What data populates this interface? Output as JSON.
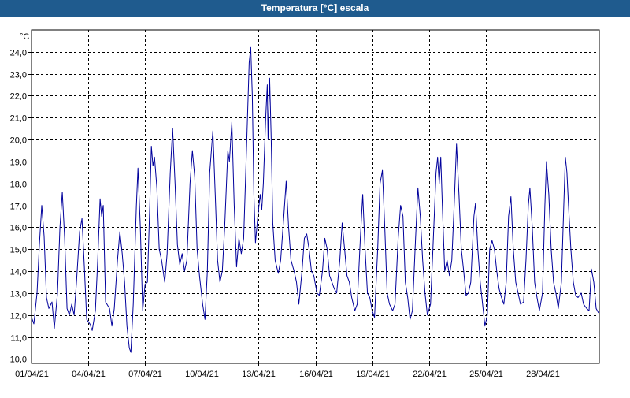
{
  "window": {
    "title": "Temperatura [°C] escala"
  },
  "colors": {
    "titlebar": "#1f5b8e",
    "series": "#00009c",
    "grid": "#000000"
  },
  "chart_data": {
    "type": "line",
    "title": "Temperatura [°C] escala",
    "ylabel": "°C",
    "xlabel": "",
    "ylim": [
      9.8,
      25.0
    ],
    "xlim": [
      "2021-04-01",
      "2021-05-01"
    ],
    "grid": true,
    "y_ticks": [
      "10,0",
      "11,0",
      "12,0",
      "13,0",
      "14,0",
      "15,0",
      "16,0",
      "17,0",
      "18,0",
      "19,0",
      "20,0",
      "21,0",
      "22,0",
      "23,0",
      "24,0"
    ],
    "x_ticks": [
      "01/04/21",
      "04/04/21",
      "07/04/21",
      "10/04/21",
      "13/04/21",
      "16/04/21",
      "19/04/21",
      "22/04/21",
      "25/04/21",
      "28/04/21"
    ],
    "x_tick_dates": [
      "2021-04-01",
      "2021-04-04",
      "2021-04-07",
      "2021-04-10",
      "2021-04-13",
      "2021-04-16",
      "2021-04-19",
      "2021-04-22",
      "2021-04-25",
      "2021-04-28"
    ],
    "series": [
      {
        "points": [
          [
            "2021-04-01 00:00",
            11.9
          ],
          [
            "2021-04-01 03:00",
            11.6
          ],
          [
            "2021-04-01 07:00",
            13.0
          ],
          [
            "2021-04-01 10:00",
            15.2
          ],
          [
            "2021-04-01 13:00",
            17.0
          ],
          [
            "2021-04-01 16:00",
            15.6
          ],
          [
            "2021-04-01 19:00",
            12.8
          ],
          [
            "2021-04-01 22:00",
            12.3
          ],
          [
            "2021-04-02 02:00",
            12.6
          ],
          [
            "2021-04-02 05:00",
            11.4
          ],
          [
            "2021-04-02 09:00",
            13.0
          ],
          [
            "2021-04-02 12:00",
            16.0
          ],
          [
            "2021-04-02 15:00",
            17.6
          ],
          [
            "2021-04-02 18:00",
            15.5
          ],
          [
            "2021-04-02 21:00",
            12.3
          ],
          [
            "2021-04-03 00:00",
            12.0
          ],
          [
            "2021-04-03 03:00",
            12.5
          ],
          [
            "2021-04-03 06:00",
            12.0
          ],
          [
            "2021-04-03 09:00",
            13.5
          ],
          [
            "2021-04-03 13:00",
            15.8
          ],
          [
            "2021-04-03 16:00",
            16.4
          ],
          [
            "2021-04-03 19:00",
            14.2
          ],
          [
            "2021-04-03 22:00",
            11.8
          ],
          [
            "2021-04-04 02:00",
            11.6
          ],
          [
            "2021-04-04 05:00",
            11.3
          ],
          [
            "2021-04-04 09:00",
            12.2
          ],
          [
            "2021-04-04 12:00",
            14.5
          ],
          [
            "2021-04-04 15:00",
            17.3
          ],
          [
            "2021-04-04 17:00",
            16.5
          ],
          [
            "2021-04-04 19:00",
            17.0
          ],
          [
            "2021-04-04 22:00",
            12.6
          ],
          [
            "2021-04-05 03:00",
            12.3
          ],
          [
            "2021-04-05 06:00",
            11.5
          ],
          [
            "2021-04-05 09:00",
            12.3
          ],
          [
            "2021-04-05 13:00",
            14.5
          ],
          [
            "2021-04-05 16:00",
            15.8
          ],
          [
            "2021-04-05 19:00",
            14.8
          ],
          [
            "2021-04-05 22:00",
            13.5
          ],
          [
            "2021-04-06 01:00",
            11.5
          ],
          [
            "2021-04-06 04:00",
            10.5
          ],
          [
            "2021-04-06 06:00",
            10.3
          ],
          [
            "2021-04-06 09:00",
            12.5
          ],
          [
            "2021-04-06 13:00",
            17.0
          ],
          [
            "2021-04-06 15:00",
            18.7
          ],
          [
            "2021-04-06 18:00",
            16.0
          ],
          [
            "2021-04-06 21:00",
            12.2
          ],
          [
            "2021-04-07 00:00",
            13.4
          ],
          [
            "2021-04-07 03:00",
            13.5
          ],
          [
            "2021-04-07 06:00",
            17.0
          ],
          [
            "2021-04-07 08:00",
            19.7
          ],
          [
            "2021-04-07 10:00",
            18.8
          ],
          [
            "2021-04-07 12:00",
            19.2
          ],
          [
            "2021-04-07 15:00",
            17.8
          ],
          [
            "2021-04-07 18:00",
            15.0
          ],
          [
            "2021-04-07 21:00",
            14.5
          ],
          [
            "2021-04-08 01:00",
            13.5
          ],
          [
            "2021-04-08 04:00",
            14.8
          ],
          [
            "2021-04-08 08:00",
            18.5
          ],
          [
            "2021-04-08 11:00",
            20.5
          ],
          [
            "2021-04-08 14:00",
            18.0
          ],
          [
            "2021-04-08 17:00",
            15.2
          ],
          [
            "2021-04-08 20:00",
            14.3
          ],
          [
            "2021-04-08 23:00",
            14.8
          ],
          [
            "2021-04-09 02:00",
            14.0
          ],
          [
            "2021-04-09 05:00",
            14.5
          ],
          [
            "2021-04-09 09:00",
            18.0
          ],
          [
            "2021-04-09 12:00",
            19.5
          ],
          [
            "2021-04-09 15:00",
            18.3
          ],
          [
            "2021-04-09 18:00",
            15.0
          ],
          [
            "2021-04-09 21:00",
            13.8
          ],
          [
            "2021-04-10 01:00",
            12.5
          ],
          [
            "2021-04-10 04:00",
            11.8
          ],
          [
            "2021-04-10 07:00",
            14.0
          ],
          [
            "2021-04-10 10:00",
            18.5
          ],
          [
            "2021-04-10 14:00",
            20.4
          ],
          [
            "2021-04-10 17:00",
            17.5
          ],
          [
            "2021-04-10 20:00",
            14.5
          ],
          [
            "2021-04-10 23:00",
            13.5
          ],
          [
            "2021-04-11 02:00",
            14.0
          ],
          [
            "2021-04-11 05:00",
            16.0
          ],
          [
            "2021-04-11 09:00",
            19.5
          ],
          [
            "2021-04-11 11:00",
            19.0
          ],
          [
            "2021-04-11 14:00",
            20.8
          ],
          [
            "2021-04-11 17:00",
            17.0
          ],
          [
            "2021-04-11 20:00",
            14.2
          ],
          [
            "2021-04-11 23:00",
            15.5
          ],
          [
            "2021-04-12 02:00",
            14.8
          ],
          [
            "2021-04-12 05:00",
            15.5
          ],
          [
            "2021-04-12 09:00",
            20.0
          ],
          [
            "2021-04-12 12:00",
            23.5
          ],
          [
            "2021-04-12 14:00",
            24.2
          ],
          [
            "2021-04-12 16:00",
            22.0
          ],
          [
            "2021-04-12 18:00",
            17.5
          ],
          [
            "2021-04-12 20:00",
            15.3
          ],
          [
            "2021-04-12 23:00",
            16.5
          ],
          [
            "2021-04-13 02:00",
            17.5
          ],
          [
            "2021-04-13 04:00",
            16.8
          ],
          [
            "2021-04-13 06:00",
            18.0
          ],
          [
            "2021-04-13 09:00",
            21.0
          ],
          [
            "2021-04-13 11:00",
            22.5
          ],
          [
            "2021-04-13 12:00",
            20.0
          ],
          [
            "2021-04-13 14:00",
            22.8
          ],
          [
            "2021-04-13 16:00",
            20.0
          ],
          [
            "2021-04-13 18:00",
            16.2
          ],
          [
            "2021-04-13 21:00",
            14.5
          ],
          [
            "2021-04-14 01:00",
            13.9
          ],
          [
            "2021-04-14 04:00",
            14.5
          ],
          [
            "2021-04-14 08:00",
            16.5
          ],
          [
            "2021-04-14 11:00",
            18.1
          ],
          [
            "2021-04-14 14:00",
            16.0
          ],
          [
            "2021-04-14 17:00",
            14.5
          ],
          [
            "2021-04-14 21:00",
            14.0
          ],
          [
            "2021-04-15 00:00",
            13.5
          ],
          [
            "2021-04-15 03:00",
            12.5
          ],
          [
            "2021-04-15 07:00",
            14.0
          ],
          [
            "2021-04-15 10:00",
            15.5
          ],
          [
            "2021-04-15 13:00",
            15.7
          ],
          [
            "2021-04-15 16:00",
            15.0
          ],
          [
            "2021-04-15 19:00",
            14.0
          ],
          [
            "2021-04-15 22:00",
            13.8
          ],
          [
            "2021-04-16 02:00",
            13.0
          ],
          [
            "2021-04-16 05:00",
            12.9
          ],
          [
            "2021-04-16 09:00",
            14.0
          ],
          [
            "2021-04-16 12:00",
            15.5
          ],
          [
            "2021-04-16 15:00",
            15.0
          ],
          [
            "2021-04-16 18:00",
            13.8
          ],
          [
            "2021-04-16 21:00",
            13.5
          ],
          [
            "2021-04-17 00:00",
            13.2
          ],
          [
            "2021-04-17 03:00",
            13.0
          ],
          [
            "2021-04-17 07:00",
            14.5
          ],
          [
            "2021-04-17 10:00",
            16.2
          ],
          [
            "2021-04-17 13:00",
            15.0
          ],
          [
            "2021-04-17 16:00",
            13.8
          ],
          [
            "2021-04-17 19:00",
            13.5
          ],
          [
            "2021-04-17 22:00",
            12.8
          ],
          [
            "2021-04-18 02:00",
            12.2
          ],
          [
            "2021-04-18 05:00",
            12.5
          ],
          [
            "2021-04-18 09:00",
            15.5
          ],
          [
            "2021-04-18 12:00",
            17.5
          ],
          [
            "2021-04-18 15:00",
            15.0
          ],
          [
            "2021-04-18 18:00",
            13.0
          ],
          [
            "2021-04-18 21:00",
            12.8
          ],
          [
            "2021-04-19 00:00",
            12.2
          ],
          [
            "2021-04-19 03:00",
            11.9
          ],
          [
            "2021-04-19 07:00",
            15.0
          ],
          [
            "2021-04-19 10:00",
            18.0
          ],
          [
            "2021-04-19 13:00",
            18.6
          ],
          [
            "2021-04-19 16:00",
            16.0
          ],
          [
            "2021-04-19 19:00",
            13.0
          ],
          [
            "2021-04-19 22:00",
            12.5
          ],
          [
            "2021-04-20 02:00",
            12.2
          ],
          [
            "2021-04-20 05:00",
            12.5
          ],
          [
            "2021-04-20 09:00",
            15.5
          ],
          [
            "2021-04-20 12:00",
            17.0
          ],
          [
            "2021-04-20 15:00",
            16.5
          ],
          [
            "2021-04-20 18:00",
            13.5
          ],
          [
            "2021-04-20 21:00",
            12.8
          ],
          [
            "2021-04-21 00:00",
            11.8
          ],
          [
            "2021-04-21 03:00",
            12.2
          ],
          [
            "2021-04-21 07:00",
            15.5
          ],
          [
            "2021-04-21 10:00",
            17.8
          ],
          [
            "2021-04-21 13:00",
            16.5
          ],
          [
            "2021-04-21 16:00",
            14.5
          ],
          [
            "2021-04-21 19:00",
            13.0
          ],
          [
            "2021-04-21 22:00",
            12.0
          ],
          [
            "2021-04-22 02:00",
            12.5
          ],
          [
            "2021-04-22 05:00",
            15.0
          ],
          [
            "2021-04-22 09:00",
            18.5
          ],
          [
            "2021-04-22 11:00",
            19.2
          ],
          [
            "2021-04-22 13:00",
            18.0
          ],
          [
            "2021-04-22 15:00",
            19.2
          ],
          [
            "2021-04-22 17:00",
            17.0
          ],
          [
            "2021-04-22 20:00",
            14.0
          ],
          [
            "2021-04-22 23:00",
            14.5
          ],
          [
            "2021-04-23 02:00",
            13.8
          ],
          [
            "2021-04-23 05:00",
            14.5
          ],
          [
            "2021-04-23 08:00",
            17.0
          ],
          [
            "2021-04-23 11:00",
            19.8
          ],
          [
            "2021-04-23 14:00",
            17.5
          ],
          [
            "2021-04-23 17:00",
            15.0
          ],
          [
            "2021-04-23 20:00",
            14.0
          ],
          [
            "2021-04-23 23:00",
            12.9
          ],
          [
            "2021-04-24 02:00",
            13.0
          ],
          [
            "2021-04-24 05:00",
            13.5
          ],
          [
            "2021-04-24 09:00",
            16.5
          ],
          [
            "2021-04-24 11:00",
            17.1
          ],
          [
            "2021-04-24 14:00",
            15.0
          ],
          [
            "2021-04-24 17:00",
            13.5
          ],
          [
            "2021-04-24 20:00",
            12.5
          ],
          [
            "2021-04-24 23:00",
            11.5
          ],
          [
            "2021-04-25 02:00",
            12.0
          ],
          [
            "2021-04-25 05:00",
            15.0
          ],
          [
            "2021-04-25 08:00",
            15.4
          ],
          [
            "2021-04-25 11:00",
            15.0
          ],
          [
            "2021-04-25 14:00",
            14.0
          ],
          [
            "2021-04-25 17:00",
            13.2
          ],
          [
            "2021-04-25 20:00",
            12.8
          ],
          [
            "2021-04-25 23:00",
            12.5
          ],
          [
            "2021-04-26 02:00",
            13.5
          ],
          [
            "2021-04-26 05:00",
            16.5
          ],
          [
            "2021-04-26 08:00",
            17.4
          ],
          [
            "2021-04-26 11:00",
            15.0
          ],
          [
            "2021-04-26 14:00",
            13.5
          ],
          [
            "2021-04-26 17:00",
            13.0
          ],
          [
            "2021-04-26 20:00",
            12.5
          ],
          [
            "2021-04-27 00:00",
            12.6
          ],
          [
            "2021-04-27 03:00",
            14.5
          ],
          [
            "2021-04-27 06:00",
            17.0
          ],
          [
            "2021-04-27 08:00",
            17.8
          ],
          [
            "2021-04-27 11:00",
            16.0
          ],
          [
            "2021-04-27 14:00",
            13.5
          ],
          [
            "2021-04-27 17:00",
            12.8
          ],
          [
            "2021-04-27 20:00",
            12.2
          ],
          [
            "2021-04-28 00:00",
            13.0
          ],
          [
            "2021-04-28 03:00",
            17.0
          ],
          [
            "2021-04-28 05:00",
            19.0
          ],
          [
            "2021-04-28 08:00",
            17.5
          ],
          [
            "2021-04-28 11:00",
            15.0
          ],
          [
            "2021-04-28 14:00",
            13.5
          ],
          [
            "2021-04-28 17:00",
            13.0
          ],
          [
            "2021-04-28 20:00",
            12.3
          ],
          [
            "2021-04-29 00:00",
            13.5
          ],
          [
            "2021-04-29 03:00",
            17.0
          ],
          [
            "2021-04-29 05:00",
            19.2
          ],
          [
            "2021-04-29 07:00",
            18.5
          ],
          [
            "2021-04-29 09:00",
            17.0
          ],
          [
            "2021-04-29 12:00",
            15.0
          ],
          [
            "2021-04-29 15:00",
            13.5
          ],
          [
            "2021-04-29 18:00",
            12.9
          ],
          [
            "2021-04-29 21:00",
            12.8
          ],
          [
            "2021-04-30 01:00",
            13.0
          ],
          [
            "2021-04-30 04:00",
            12.5
          ],
          [
            "2021-04-30 08:00",
            12.3
          ],
          [
            "2021-04-30 11:00",
            12.2
          ],
          [
            "2021-04-30 14:00",
            14.1
          ],
          [
            "2021-04-30 17:00",
            13.5
          ],
          [
            "2021-04-30 20:00",
            12.3
          ],
          [
            "2021-04-30 23:00",
            12.1
          ]
        ]
      }
    ]
  }
}
